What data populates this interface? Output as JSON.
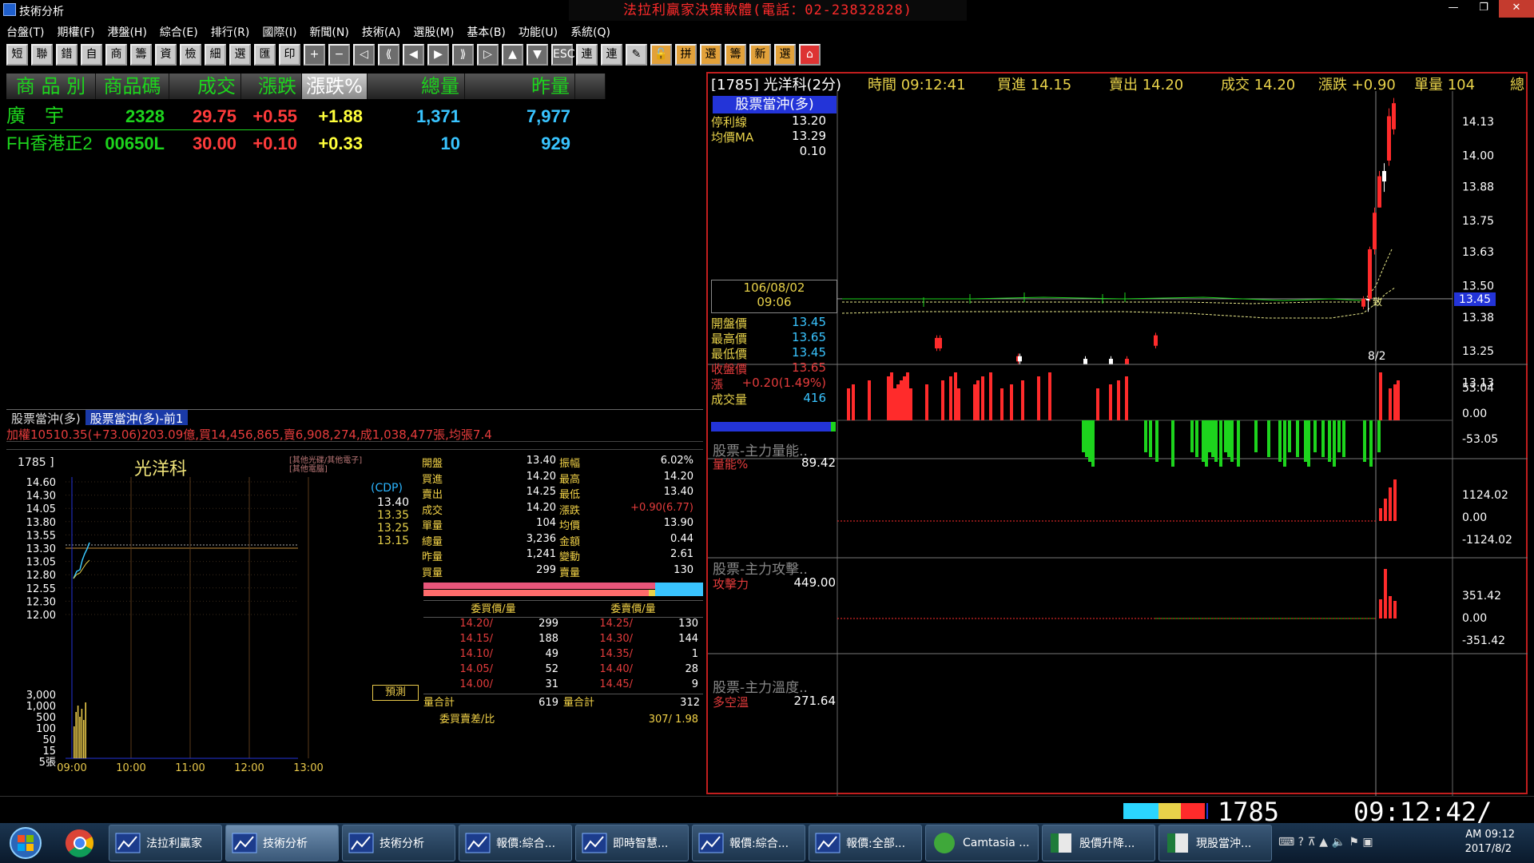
{
  "window": {
    "title": "技術分析",
    "banner": "法拉利贏家決策軟體(電話：02-23832828)"
  },
  "menu": [
    "台盤(T)",
    "期權(F)",
    "港盤(H)",
    "綜合(E)",
    "排行(R)",
    "國際(I)",
    "新聞(N)",
    "技術(A)",
    "選股(M)",
    "基本(B)",
    "功能(U)",
    "系統(Q)"
  ],
  "toolbar": [
    "短",
    "聯",
    "錯",
    "自",
    "商",
    "籌",
    "資",
    "檢",
    "細",
    "選",
    "匯",
    "印",
    "+",
    "−",
    "◁",
    "⟪",
    "◀",
    "▶",
    "⟫",
    "▷",
    "▲",
    "▼",
    "ESC",
    "連",
    "連",
    "✎",
    "🔓",
    "拼",
    "選",
    "籌",
    "新",
    "選",
    "⌂"
  ],
  "watchlist": {
    "headers": [
      "商 品 別",
      "商品碼",
      "成交",
      "漲跌",
      "漲跌%",
      "總量",
      "昨量"
    ],
    "rows": [
      {
        "name": "廣　宇",
        "code": "2328",
        "price": "29.75",
        "change": "+0.55",
        "pct": "+1.88",
        "vol": "1,371",
        "prev": "7,977"
      },
      {
        "name": "FH香港正2",
        "code": "00650L",
        "price": "30.00",
        "change": "+0.10",
        "pct": "+0.33",
        "vol": "10",
        "prev": "929"
      }
    ],
    "tabs": [
      "股票當沖(多)",
      "股票當沖(多)-前1"
    ],
    "ticker": "加權10510.35(+73.06)203.09億,買14,456,865,賣6,908,274,成1,038,477張,均張7.4"
  },
  "mini": {
    "code": "1785 ]",
    "name": "光洋科",
    "sub1": "[其他光碟/其他電子]",
    "sub2": "[其他電腦]",
    "price_axis": [
      "14.60",
      "14.30",
      "14.05",
      "13.80",
      "13.55",
      "13.30",
      "13.05",
      "12.80",
      "12.55",
      "12.30",
      "12.00"
    ],
    "vol_axis": [
      "3,000",
      "1,000",
      "500",
      "100",
      "50",
      "15",
      "5張"
    ],
    "time_axis": [
      "09:00",
      "10:00",
      "11:00",
      "12:00",
      "13:00"
    ],
    "cdp_label": "(CDP)",
    "cdp_values": [
      "13.40",
      "13.35",
      "13.25",
      "13.15"
    ],
    "predict": "預測",
    "quote_left": [
      [
        "開盤",
        "13.40"
      ],
      [
        "買進",
        "14.20"
      ],
      [
        "賣出",
        "14.25"
      ],
      [
        "成交",
        "14.20"
      ],
      [
        "單量",
        "104"
      ],
      [
        "總量",
        "3,236"
      ],
      [
        "昨量",
        "1,241"
      ],
      [
        "買量",
        "299"
      ]
    ],
    "quote_right": [
      [
        "振幅",
        "6.02%"
      ],
      [
        "最高",
        "14.20"
      ],
      [
        "最低",
        "13.40"
      ],
      [
        "漲跌",
        "+0.90(6.77)"
      ],
      [
        "均價",
        "13.90"
      ],
      [
        "金額",
        "0.44"
      ],
      [
        "變動",
        "2.61"
      ],
      [
        "賣量",
        "130"
      ]
    ],
    "ob_headers": [
      "委買價/量",
      "委賣價/量"
    ],
    "ob_rows": [
      [
        "14.20/",
        "299",
        "14.25/",
        "130"
      ],
      [
        "14.15/",
        "188",
        "14.30/",
        "144"
      ],
      [
        "14.10/",
        "49",
        "14.35/",
        "1"
      ],
      [
        "14.05/",
        "52",
        "14.40/",
        "28"
      ],
      [
        "14.00/",
        "31",
        "14.45/",
        "9"
      ]
    ],
    "ob_total": [
      "量合計",
      "619",
      "量合計",
      "312"
    ],
    "ob_diff": [
      "委買賣差/比",
      "307/ 1.98"
    ]
  },
  "main": {
    "header": {
      "symbol": "[1785] 光洋科(2分)",
      "time": "時間 09:12:41",
      "bid": "買進 14.15",
      "ask": "賣出 14.20",
      "last": "成交 14.20",
      "chg": "漲跌 +0.90",
      "single": "單量 104",
      "extra": "總"
    },
    "panel_title": "股票當沖(多)",
    "info": [
      [
        "停利線",
        "13.20"
      ],
      [
        "均價MA",
        "13.29"
      ],
      [
        "",
        "0.10"
      ]
    ],
    "date": "106/08/02",
    "time": "09:06",
    "ohlc": [
      [
        "開盤價",
        "13.45"
      ],
      [
        "最高價",
        "13.65"
      ],
      [
        "最低價",
        "13.45"
      ],
      [
        "收盤價",
        "13.65"
      ],
      [
        "漲",
        "+0.20(1.49%)"
      ],
      [
        "成交量",
        "416"
      ]
    ],
    "price_axis": [
      "14.13",
      "14.00",
      "13.88",
      "13.75",
      "13.63",
      "13.50",
      "13.38",
      "13.25",
      "13.13"
    ],
    "current_tag": "13.45",
    "date_axis": "8/2",
    "sub1": {
      "title": "股票-主力量能..",
      "label": "量能%",
      "value": "89.42",
      "axis": [
        "53.04",
        "0.00",
        "-53.05"
      ]
    },
    "sub2": {
      "title": "股票-主力攻擊..",
      "label": "攻擊力",
      "value": "449.00",
      "axis": [
        "1124.02",
        "0.00",
        "-1124.02"
      ]
    },
    "sub3": {
      "title": "股票-主力溫度..",
      "label": "多空溫",
      "value": "271.64",
      "axis": [
        "351.42",
        "0.00",
        "-351.42"
      ]
    }
  },
  "status": {
    "code": "1785_",
    "time": "09:12:42/"
  },
  "taskbar": {
    "tasks": [
      "法拉利贏家",
      "技術分析",
      "技術分析",
      "報價:綜合...",
      "即時智慧...",
      "報價:綜合...",
      "報價:全部...",
      "Camtasia ...",
      "股價升降...",
      "現股當沖..."
    ],
    "time": "AM 09:12",
    "date": "2017/8/2"
  }
}
